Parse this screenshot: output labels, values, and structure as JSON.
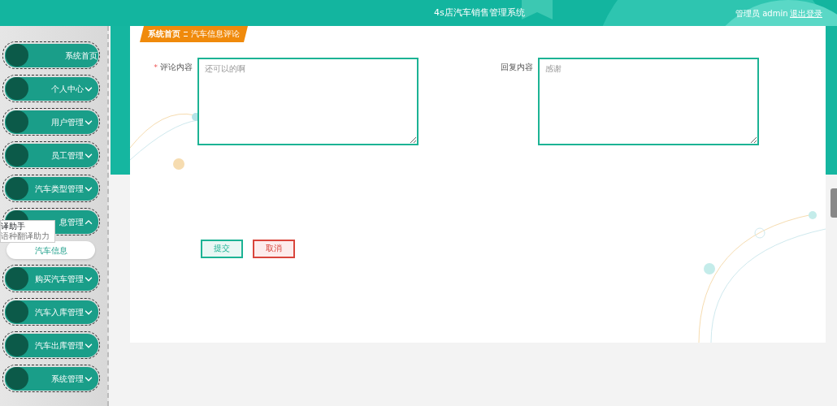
{
  "header": {
    "title": "4s店汽车销售管理系统",
    "user": "管理员 admin",
    "logout": "退出登录"
  },
  "sidebar": {
    "items": [
      {
        "label": "系统首页",
        "kind": "link"
      },
      {
        "label": "个人中心",
        "kind": "menu",
        "expanded": false
      },
      {
        "label": "用户管理",
        "kind": "menu",
        "expanded": false
      },
      {
        "label": "员工管理",
        "kind": "menu",
        "expanded": false
      },
      {
        "label": "汽车类型管理",
        "kind": "menu",
        "expanded": false
      },
      {
        "label": "息管理",
        "kind": "menu",
        "expanded": true,
        "children": [
          {
            "label": "汽车信息"
          }
        ]
      },
      {
        "label": "购买汽车管理",
        "kind": "menu",
        "expanded": false
      },
      {
        "label": "汽车入库管理",
        "kind": "menu",
        "expanded": false
      },
      {
        "label": "汽车出库管理",
        "kind": "menu",
        "expanded": false
      },
      {
        "label": "系统管理",
        "kind": "menu",
        "expanded": false
      }
    ]
  },
  "popup": {
    "title": "译助手",
    "subtitle": "语种翻译助力"
  },
  "breadcrumb": [
    "系统首页",
    "汽车信息评论"
  ],
  "form": {
    "fields": [
      {
        "required_mark": "*",
        "label": "评论内容",
        "placeholder": "还可以的啊"
      },
      {
        "label": "回复内容",
        "placeholder": "感谢"
      }
    ],
    "buttons": [
      {
        "label": "提交",
        "kind": "primary"
      },
      {
        "label": "取消",
        "kind": "danger"
      }
    ]
  }
}
